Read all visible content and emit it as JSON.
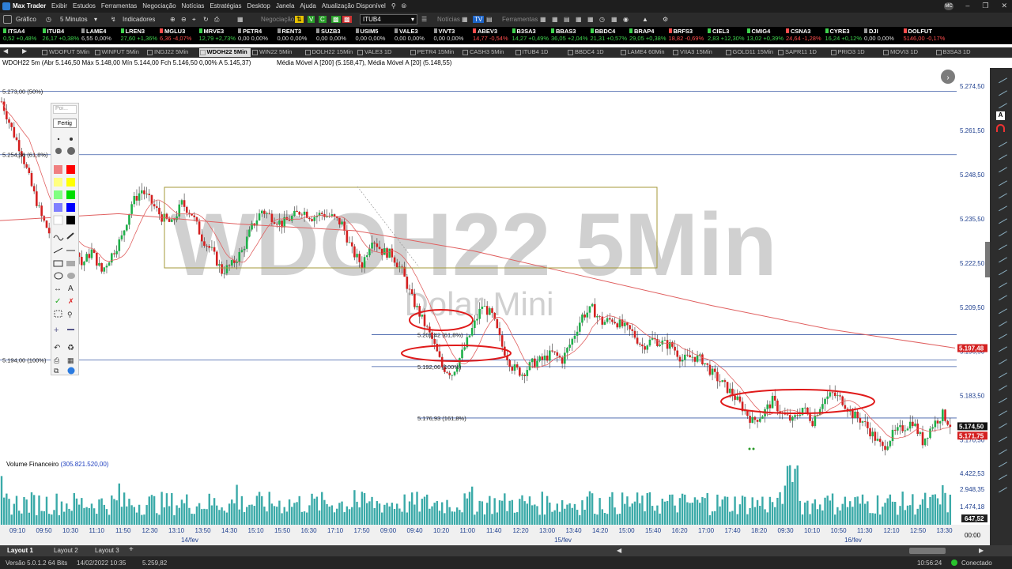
{
  "app": {
    "title": "Max Trader",
    "menus": [
      "Exibir",
      "Estudos",
      "Ferramentas",
      "Negociação",
      "Notícias",
      "Estratégias",
      "Desktop",
      "Janela",
      "Ajuda",
      "Atualização Disponível"
    ],
    "account": "MC"
  },
  "toolbar": {
    "grafico": "Gráfico",
    "interval": "5 Minutos",
    "indicadores": "Indicadores",
    "negociacao": "Negociação",
    "symbol": "ITUB4",
    "noticias": "Notícias",
    "ferramentas": "Ferramentas"
  },
  "ticker": [
    {
      "n": "ITSA4",
      "v": "0,52",
      "p": "+0,48%",
      "d": "up"
    },
    {
      "n": "ITUB4",
      "v": "26,17",
      "p": "+0,38%",
      "d": "up"
    },
    {
      "n": "LAME4",
      "v": "6,55",
      "p": "0,00%",
      "d": "fl"
    },
    {
      "n": "LREN3",
      "v": "27,60",
      "p": "+1,36%",
      "d": "up"
    },
    {
      "n": "MGLU3",
      "v": "6,36",
      "p": "-4,07%",
      "d": "dn"
    },
    {
      "n": "MRVE3",
      "v": "12,79",
      "p": "+2,73%",
      "d": "up"
    },
    {
      "n": "PETR4",
      "v": "0,00",
      "p": "0,00%",
      "d": "fl"
    },
    {
      "n": "RENT3",
      "v": "0,00",
      "p": "0,00%",
      "d": "fl"
    },
    {
      "n": "SUZB3",
      "v": "0,00",
      "p": "0,00%",
      "d": "fl"
    },
    {
      "n": "USIM5",
      "v": "0,00",
      "p": "0,00%",
      "d": "fl"
    },
    {
      "n": "VALE3",
      "v": "0,00",
      "p": "0,00%",
      "d": "fl"
    },
    {
      "n": "VIVT3",
      "v": "0,00",
      "p": "0,00%",
      "d": "fl"
    },
    {
      "n": "ABEV3",
      "v": "14,77",
      "p": "-0,54%",
      "d": "dn"
    },
    {
      "n": "B3SA3",
      "v": "14,27",
      "p": "+0,49%",
      "d": "up"
    },
    {
      "n": "BBAS3",
      "v": "36,05",
      "p": "+2,04%",
      "d": "up"
    },
    {
      "n": "BBDC4",
      "v": "21,31",
      "p": "+0,57%",
      "d": "up"
    },
    {
      "n": "BRAP4",
      "v": "29,05",
      "p": "+0,38%",
      "d": "up"
    },
    {
      "n": "BRFS3",
      "v": "18,82",
      "p": "-0,69%",
      "d": "dn"
    },
    {
      "n": "CIEL3",
      "v": "2,83",
      "p": "+12,30%",
      "d": "up"
    },
    {
      "n": "CMIG4",
      "v": "13,02",
      "p": "+0,39%",
      "d": "up"
    },
    {
      "n": "CSNA3",
      "v": "24,64",
      "p": "-1,28%",
      "d": "dn"
    },
    {
      "n": "CYRE3",
      "v": "16,24",
      "p": "+0,12%",
      "d": "up"
    },
    {
      "n": "DJI",
      "v": "0,00",
      "p": "0,00%",
      "d": "fl"
    },
    {
      "n": "DOLFUT",
      "v": "5146,00",
      "p": "-0,17%",
      "d": "dn"
    }
  ],
  "tabs": [
    "WDOFUT 5Min",
    "WINFUT 5Min",
    "INDJ22 5Min",
    "WDOH22 5Min",
    "WIN22 5Min",
    "DOLH22 15Min",
    "VALE3 1D",
    "PETR4 15Min",
    "CASH3 5Min",
    "ITUB4 1D",
    "BBDC4 1D",
    "LAME4 60Min",
    "VIIA3 15Min",
    "GOLD11 15Min",
    "SAPR11 1D",
    "PRIO3 1D",
    "MOVI3 1D",
    "B3SA3 1D"
  ],
  "activeTab": 3,
  "info": {
    "main": "WDOH22 5m (Abr 5.146,50 Máx 5.148,00 Mín 5.144,00 Fch 5.146,50  0,00%  A 5.145,37)",
    "ma": "Média Móvel A [200] (5.158,47), Média Móvel A [20] (5.148,55)"
  },
  "watermark": {
    "symbol": "WDOH22 5Min",
    "name": "Dolar Mini"
  },
  "chart_data": {
    "type": "candlestick",
    "price_axis": [
      "5.274,50",
      "5.261,50",
      "5.248,50",
      "5.235,50",
      "5.222,50",
      "5.209,50",
      "5.196,50",
      "5.183,50",
      "5.170,50"
    ],
    "ylim": [
      5166,
      5278
    ],
    "current_price": "5.174,50",
    "ma200_label": "5.197,48",
    "ma20_label": "5.171,75",
    "fib_labels": [
      "5.273,00 (50%)",
      "5.254,36 (61,8%)",
      "5.194,00 (100%)",
      "5.201,42 (61,8%)",
      "5.192,06 (100%)",
      "5.176,93 (161,8%)"
    ],
    "volume_title": "Volume Financeiro",
    "volume_value": "(305.821.520,00)",
    "volume_axis": [
      "4.422,53",
      "2.948,35",
      "1.474,18"
    ],
    "volume_last": "647,52",
    "time_labels": [
      "09:10",
      "09:50",
      "10:30",
      "11:10",
      "11:50",
      "12:30",
      "13:10",
      "13:50",
      "14:30",
      "15:10",
      "15:50",
      "16:30",
      "17:10",
      "17:50",
      "09:00",
      "09:40",
      "10:20",
      "11:00",
      "11:40",
      "12:20",
      "13:00",
      "13:40",
      "14:20",
      "15:00",
      "15:40",
      "16:20",
      "17:00",
      "17:40",
      "18:20",
      "09:30",
      "10:10",
      "10:50",
      "11:30",
      "12:10",
      "12:50",
      "13:30"
    ],
    "date_labels": [
      "14/fev",
      "15/fev",
      "16/fev"
    ],
    "axis_time": "00:00",
    "series_path": [
      [
        0,
        5270
      ],
      [
        2,
        5262
      ],
      [
        4,
        5255
      ],
      [
        6,
        5245
      ],
      [
        8,
        5236
      ],
      [
        10,
        5230
      ],
      [
        12,
        5228
      ],
      [
        14,
        5232
      ],
      [
        16,
        5222
      ],
      [
        18,
        5226
      ],
      [
        20,
        5220
      ],
      [
        22,
        5225
      ],
      [
        24,
        5230
      ],
      [
        26,
        5240
      ],
      [
        28,
        5244
      ],
      [
        30,
        5240
      ],
      [
        32,
        5236
      ],
      [
        34,
        5234
      ],
      [
        36,
        5240
      ],
      [
        38,
        5237
      ],
      [
        40,
        5230
      ],
      [
        42,
        5226
      ],
      [
        44,
        5220
      ],
      [
        46,
        5222
      ],
      [
        48,
        5226
      ],
      [
        50,
        5233
      ],
      [
        52,
        5238
      ],
      [
        54,
        5236
      ],
      [
        56,
        5234
      ],
      [
        58,
        5236
      ],
      [
        60,
        5238
      ],
      [
        62,
        5236
      ],
      [
        64,
        5237
      ],
      [
        66,
        5236
      ],
      [
        68,
        5234
      ],
      [
        70,
        5226
      ],
      [
        72,
        5222
      ],
      [
        74,
        5230
      ],
      [
        76,
        5226
      ],
      [
        78,
        5225
      ],
      [
        80,
        5220
      ],
      [
        82,
        5212
      ],
      [
        84,
        5206
      ],
      [
        86,
        5200
      ],
      [
        88,
        5192
      ],
      [
        90,
        5190
      ],
      [
        92,
        5196
      ],
      [
        94,
        5203
      ],
      [
        96,
        5210
      ],
      [
        98,
        5207
      ],
      [
        100,
        5198
      ],
      [
        102,
        5192
      ],
      [
        104,
        5190
      ],
      [
        106,
        5193
      ],
      [
        108,
        5194
      ],
      [
        110,
        5196
      ],
      [
        112,
        5194
      ],
      [
        114,
        5200
      ],
      [
        116,
        5207
      ],
      [
        118,
        5209
      ],
      [
        120,
        5205
      ],
      [
        122,
        5206
      ],
      [
        124,
        5204
      ],
      [
        126,
        5202
      ],
      [
        128,
        5198
      ],
      [
        130,
        5200
      ],
      [
        132,
        5199
      ],
      [
        134,
        5198
      ],
      [
        136,
        5194
      ],
      [
        138,
        5195
      ],
      [
        140,
        5194
      ],
      [
        142,
        5190
      ],
      [
        144,
        5187
      ],
      [
        146,
        5184
      ],
      [
        148,
        5180
      ],
      [
        150,
        5176
      ],
      [
        152,
        5178
      ],
      [
        154,
        5182
      ],
      [
        156,
        5178
      ],
      [
        158,
        5176
      ],
      [
        160,
        5180
      ],
      [
        162,
        5176
      ],
      [
        164,
        5182
      ],
      [
        166,
        5184
      ],
      [
        168,
        5182
      ],
      [
        170,
        5178
      ],
      [
        172,
        5176
      ],
      [
        174,
        5172
      ],
      [
        176,
        5168
      ],
      [
        178,
        5172
      ],
      [
        180,
        5174
      ],
      [
        182,
        5176
      ],
      [
        184,
        5170
      ],
      [
        186,
        5175
      ],
      [
        188,
        5178
      ],
      [
        190,
        5174
      ]
    ]
  },
  "layout_tabs": [
    "Layout 1",
    "Layout 2",
    "Layout 3"
  ],
  "status": {
    "version": "Versão 5.0.1.2 64 Bits",
    "datetime": "14/02/2022 10:35",
    "price": "5.259,82",
    "clock": "10:56:24",
    "conn": "Conectado"
  },
  "panel": {
    "poi": "Poi...",
    "fertig": "Fertig"
  }
}
